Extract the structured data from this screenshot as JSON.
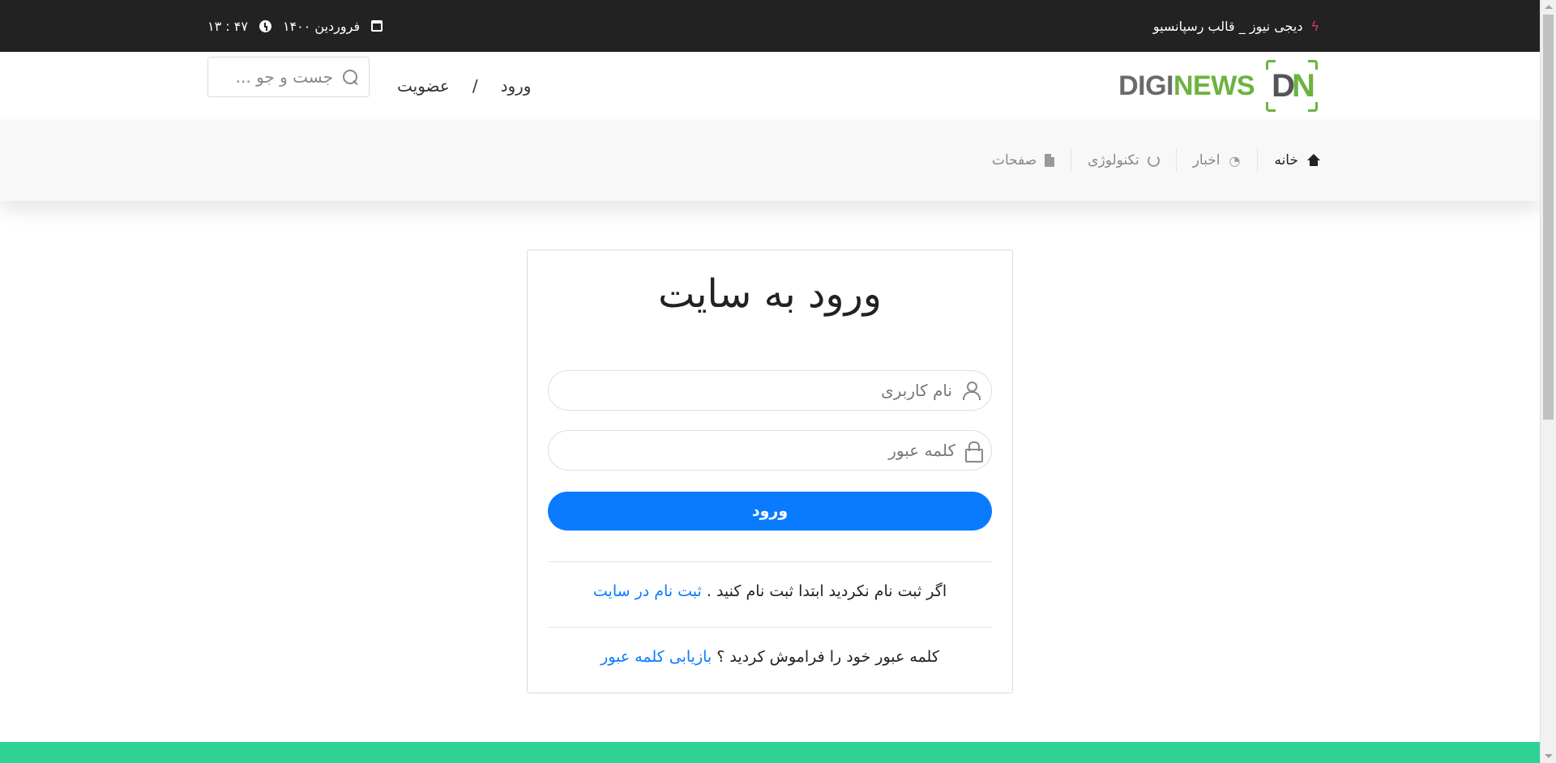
{
  "topbar": {
    "ticker_text": "دیجی نیوز _ قالب رسپانسیو",
    "date": "فروردین ۱۴۰۰",
    "time": "۱۳ : ۴۷"
  },
  "header": {
    "logo_word_part1": "DIGI",
    "logo_word_part2": "NEWS",
    "logo_mark_d": "D",
    "logo_mark_n": "N",
    "login_link": "ورود",
    "separator": "/",
    "register_link": "عضویت",
    "search_placeholder": "جست و جو ..."
  },
  "nav": {
    "items": [
      {
        "label": "خانه",
        "icon": "home-icon"
      },
      {
        "label": "اخبار",
        "icon": "rss-icon"
      },
      {
        "label": "تکنولوژی",
        "icon": "circle-notch-icon"
      },
      {
        "label": "صفحات",
        "icon": "file-icon"
      }
    ]
  },
  "login": {
    "title": "ورود به سایت",
    "username_placeholder": "نام کاربری",
    "password_placeholder": "کلمه عبور",
    "submit_label": "ورود",
    "register_note": "اگر ثبت نام نکردید ابتدا ثبت نام کنید .",
    "register_link": "ثبت نام در سایت",
    "forgot_note": "کلمه عبور خود را فراموش کردید ؟",
    "forgot_link": "بازیابی کلمه عبور"
  },
  "colors": {
    "topbar_bg": "#222222",
    "accent_blue": "#0a7bff",
    "brand_green": "#6cb33f",
    "footer_green": "#2fd294",
    "bolt_red": "#e8365d"
  }
}
